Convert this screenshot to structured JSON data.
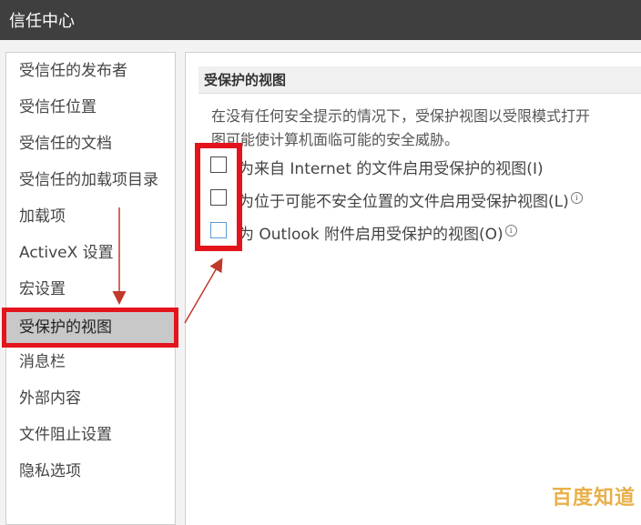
{
  "window": {
    "title": "信任中心"
  },
  "sidebar": {
    "items": [
      {
        "label": "受信任的发布者"
      },
      {
        "label": "受信任位置"
      },
      {
        "label": "受信任的文档"
      },
      {
        "label": "受信任的加载项目录"
      },
      {
        "label": "加载项"
      },
      {
        "label": "ActiveX 设置"
      },
      {
        "label": "宏设置"
      },
      {
        "label": "受保护的视图",
        "selected": true
      },
      {
        "label": "消息栏"
      },
      {
        "label": "外部内容"
      },
      {
        "label": "文件阻止设置"
      },
      {
        "label": "隐私选项"
      }
    ]
  },
  "main": {
    "section_title": "受保护的视图",
    "description_line1": "在没有任何安全提示的情况下，受保护视图以受限模式打开",
    "description_line2": "图可能使计算机面临可能的安全威胁。",
    "options": [
      {
        "label": "为来自 Internet 的文件启用受保护的视图(I)",
        "checked": false,
        "info": false
      },
      {
        "label": "为位于可能不安全位置的文件启用受保护视图(L)",
        "checked": false,
        "info": true
      },
      {
        "label": "为 Outlook 附件启用受保护的视图(O)",
        "checked": false,
        "info": true
      }
    ]
  },
  "watermark": "百度知道",
  "colors": {
    "titlebar": "#3f3f3f",
    "highlight_red": "#e3141c",
    "selected_bg": "#c8c8c8"
  }
}
